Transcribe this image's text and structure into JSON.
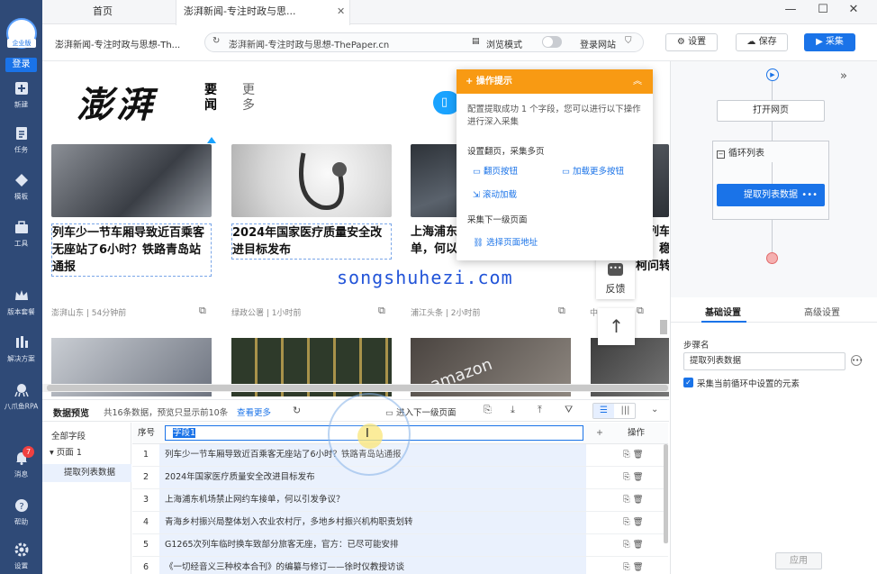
{
  "sidebar": {
    "edition": "企业版",
    "login": "登录",
    "items": [
      {
        "label": "新建",
        "icon": "plus-icon"
      },
      {
        "label": "任务",
        "icon": "task-icon"
      },
      {
        "label": "模板",
        "icon": "template-icon"
      },
      {
        "label": "工具",
        "icon": "toolbox-icon"
      },
      {
        "label": "版本套餐",
        "icon": "crown-icon"
      },
      {
        "label": "解决方案",
        "icon": "solution-icon"
      },
      {
        "label": "八爪鱼RPA",
        "icon": "octopus-icon"
      },
      {
        "label": "消息",
        "icon": "bell-icon"
      },
      {
        "label": "帮助",
        "icon": "help-icon"
      },
      {
        "label": "设置",
        "icon": "gear-icon"
      }
    ],
    "message_count": "7"
  },
  "tabs": {
    "home": "首页",
    "active": "澎湃新闻-专注时政与思..."
  },
  "address": {
    "page_title": "澎湃新闻-专注时政与思想-Th...",
    "url": "澎湃新闻-专注时政与思想-ThePaper.cn",
    "browse_mode": "浏览模式",
    "login_site": "登录网站",
    "settings": "设置",
    "save": "保存",
    "collect": "采集"
  },
  "webpage": {
    "logo": "澎湃",
    "nav_news": "要闻",
    "nav_more": "更多",
    "cards": [
      {
        "title": "列车少一节车厢导致近百乘客无座站了6小时？铁路青岛站通报",
        "meta": "澎湃山东 | 54分钟前"
      },
      {
        "title": "2024年国家医疗质量安全改进目标发布",
        "meta": "绿政公署 | 1小时前"
      },
      {
        "title": "上海浦东\n单，何以",
        "meta": "浦江头条 | 2小时前"
      },
      {
        "title": "列车\n稳\n柯问转",
        "meta": "中国政..."
      }
    ],
    "feedback": "反馈"
  },
  "hint": {
    "title": "操作提示",
    "desc": "配置提取成功 1 个字段，您可以进行以下操作进行深入采集",
    "section1": "设置翻页，采集多页",
    "link_page_button": "翻页按钮",
    "link_load_more": "加载更多按钮",
    "link_scroll_load": "滚动加载",
    "section2": "采集下一级页面",
    "link_select_url": "选择页面地址"
  },
  "watermark": "songshuhezi.com",
  "preview": {
    "title": "数据预览",
    "count": "共16条数据，预览只显示前10条",
    "view_more": "查看更多",
    "next_level": "进入下一级页面",
    "view_list": "☰",
    "view_cols": "|||"
  },
  "tree": {
    "all_fields": "全部字段",
    "page1": "页面 1",
    "extract": "提取列表数据"
  },
  "table": {
    "col_index": "序号",
    "field_name": "字段1",
    "col_add": "+",
    "col_op": "操作",
    "rows": [
      {
        "n": "1",
        "v": "列车少一节车厢导致近百乘客无座站了6小时？铁路青岛站通报"
      },
      {
        "n": "2",
        "v": "2024年国家医疗质量安全改进目标发布"
      },
      {
        "n": "3",
        "v": "上海浦东机场禁止网约车接单，何以引发争议？"
      },
      {
        "n": "4",
        "v": "青海乡村振兴局整体划入农业农村厅，多地乡村振兴机构职责划转"
      },
      {
        "n": "5",
        "v": "G1265次列车临时换车致部分旅客无座，官方：已尽可能安排"
      },
      {
        "n": "6",
        "v": "《一切经音义三种校本合刊》的编纂与修订——徐时仪教授访谈"
      }
    ]
  },
  "flow": {
    "open_page": "打开网页",
    "loop_list": "循环列表",
    "extract_list": "提取列表数据",
    "more": "•••"
  },
  "settings_panel": {
    "tab_basic": "基础设置",
    "tab_advanced": "高级设置",
    "step_name_label": "步骤名",
    "step_name_value": "提取列表数据",
    "checkbox_label": "采集当前循环中设置的元素",
    "apply": "应用"
  },
  "colors": {
    "sidebar": "#2f4a77",
    "accent": "#1a73e8",
    "hint_header": "#f89a13"
  }
}
